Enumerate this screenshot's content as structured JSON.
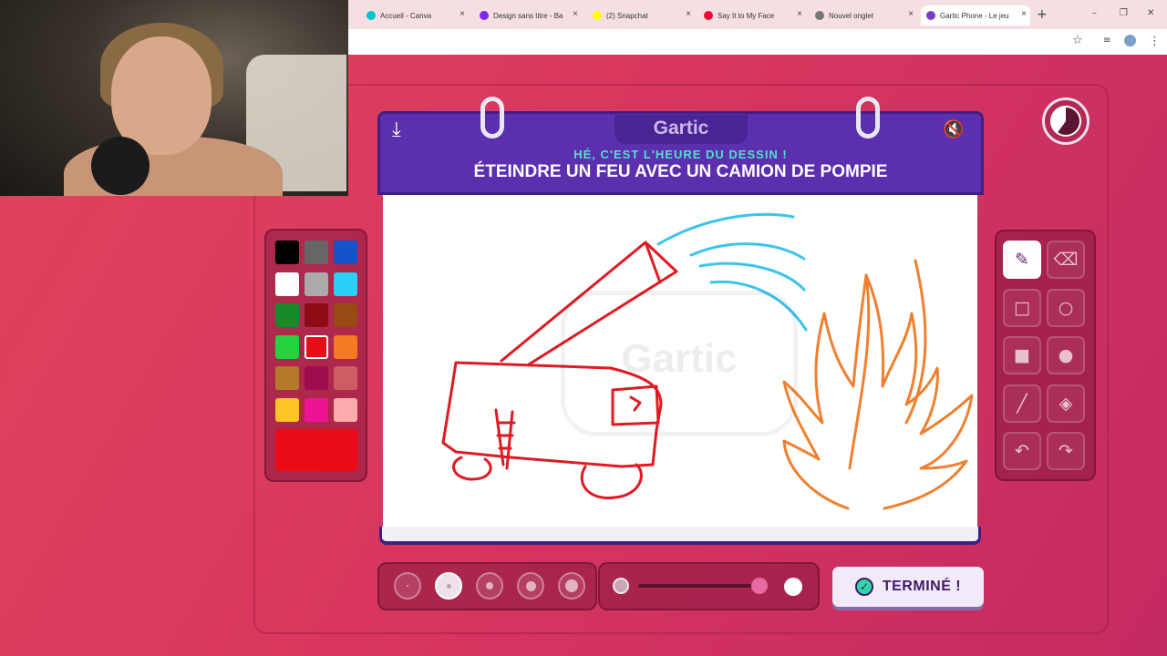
{
  "browser": {
    "tabs": [
      {
        "label": "Accueil - Canva",
        "color": "#00c4cc"
      },
      {
        "label": "Design sans titre - Ba",
        "color": "#7d2ae8"
      },
      {
        "label": "(2) Snapchat",
        "color": "#fffc00"
      },
      {
        "label": "Say It to My Face",
        "color": "#ff0033"
      },
      {
        "label": "Nouvel onglet",
        "color": "#777777"
      },
      {
        "label": "Gartic Phone - Le jeu",
        "color": "#7a3fc2"
      }
    ],
    "new_tab": "+",
    "window_controls": {
      "minimize": "–",
      "restore": "❐",
      "close": "✕"
    },
    "toolbar": {
      "star": "☆",
      "menu": "⋮"
    }
  },
  "game": {
    "logo": "Gartic",
    "subtitle": "HÉ, C'EST L'HEURE DU DESSIN !",
    "title": "ÉTEINDRE UN FEU AVEC UN CAMION DE POMPIE",
    "watermark": "Gartic",
    "download_icon": "download-icon",
    "mute_icon": "speaker-muted-icon",
    "mute_glyph": "🔇",
    "download_glyph": "⤓",
    "timer_remaining_fraction": 0.4,
    "done_label": "TERMINÉ !",
    "done_glyph": "✓"
  },
  "palette": {
    "colors": [
      "#000000",
      "#666666",
      "#1652c9",
      "#ffffff",
      "#aaaaaa",
      "#2ccff5",
      "#168a29",
      "#8c0b14",
      "#974a14",
      "#24d13e",
      "#ea0b16",
      "#f47a24",
      "#b5792a",
      "#9e0e4f",
      "#cf5c65",
      "#fcc425",
      "#ec1494",
      "#fbabab"
    ],
    "selected_index": 10,
    "current_color": "#ea0b16"
  },
  "tools": [
    {
      "name": "pen-tool",
      "glyph": "✎",
      "selected": true
    },
    {
      "name": "eraser-tool",
      "glyph": "⌫",
      "selected": false
    },
    {
      "name": "rectangle-outline-tool",
      "glyph": "□",
      "selected": false
    },
    {
      "name": "ellipse-outline-tool",
      "glyph": "○",
      "selected": false
    },
    {
      "name": "rectangle-fill-tool",
      "glyph": "■",
      "selected": false
    },
    {
      "name": "ellipse-fill-tool",
      "glyph": "●",
      "selected": false
    },
    {
      "name": "line-tool",
      "glyph": "╱",
      "selected": false
    },
    {
      "name": "fill-bucket-tool",
      "glyph": "◈",
      "selected": false
    },
    {
      "name": "undo-tool",
      "glyph": "↶",
      "selected": false
    },
    {
      "name": "redo-tool",
      "glyph": "↷",
      "selected": false
    }
  ],
  "brush_sizes": {
    "count": 5,
    "selected_index": 1
  },
  "opacity_slider": {
    "value_fraction": 0.95
  }
}
